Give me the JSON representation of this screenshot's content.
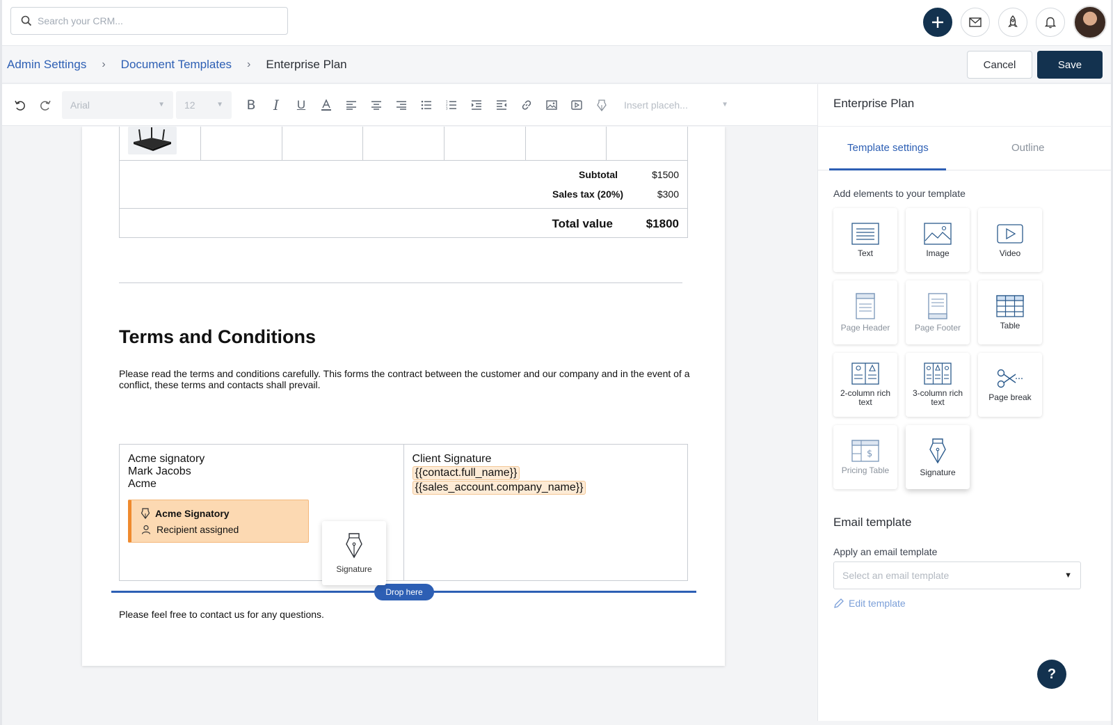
{
  "search": {
    "placeholder": "Search your CRM..."
  },
  "breadcrumb": {
    "items": [
      "Admin Settings",
      "Document Templates"
    ],
    "current": "Enterprise Plan"
  },
  "actions": {
    "cancel_label": "Cancel",
    "save_label": "Save"
  },
  "toolbar": {
    "font": "Arial",
    "size": "12",
    "placeholder_select": "Insert placeh..."
  },
  "document": {
    "totals": [
      {
        "label": "Subtotal",
        "value": "$1500"
      },
      {
        "label": "Sales tax (20%)",
        "value": "$300"
      }
    ],
    "total_label": "Total value",
    "total_value": "$1800",
    "terms_title": "Terms and Conditions",
    "terms_text": "Please read the terms and conditions carefully. This forms the contract between the customer and our company and in the event of a conflict, these terms and contacts shall prevail.",
    "signatory": {
      "line1": "Acme signatory",
      "line2": "Mark Jacobs",
      "line3": "Acme"
    },
    "sig_block": {
      "title": "Acme Signatory",
      "subtitle": "Recipient assigned"
    },
    "client": {
      "title": "Client Signature",
      "token1": "{{contact.full_name}}",
      "token2": "{{sales_account.company_name}}"
    },
    "drag_label": "Signature",
    "drop_label": "Drop here",
    "contact_text": "Please feel free to contact us for any questions."
  },
  "panel": {
    "title": "Enterprise Plan",
    "tabs": [
      "Template settings",
      "Outline"
    ],
    "add_label": "Add elements to your template",
    "tiles": [
      {
        "label": "Text",
        "icon": "text-icon"
      },
      {
        "label": "Image",
        "icon": "image-icon"
      },
      {
        "label": "Video",
        "icon": "video-icon"
      },
      {
        "label": "Page Header",
        "icon": "page-header-icon"
      },
      {
        "label": "Page Footer",
        "icon": "page-footer-icon"
      },
      {
        "label": "Table",
        "icon": "table-icon"
      },
      {
        "label": "2-column rich text",
        "icon": "two-column-icon"
      },
      {
        "label": "3-column rich text",
        "icon": "three-column-icon"
      },
      {
        "label": "Page break",
        "icon": "scissors-icon"
      },
      {
        "label": "Pricing Table",
        "icon": "pricing-table-icon"
      },
      {
        "label": "Signature",
        "icon": "pen-nib-icon"
      }
    ],
    "email_heading": "Email template",
    "apply_label": "Apply an email template",
    "email_placeholder": "Select an email template",
    "edit_label": "Edit template"
  },
  "help_label": "?",
  "colors": {
    "primary": "#13324f",
    "link": "#2d5fb4",
    "signature_fill": "#fcd9b2",
    "signature_accent": "#ef8a2e"
  }
}
